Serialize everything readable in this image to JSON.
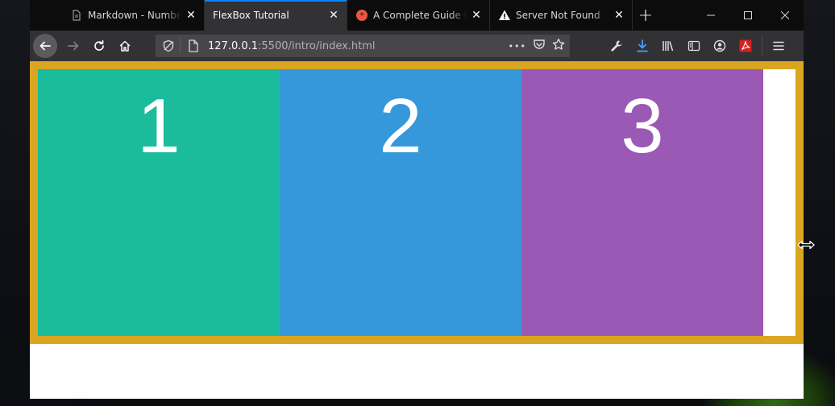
{
  "browser": {
    "tabs": [
      {
        "title": "Markdown - Numbered",
        "favicon": "document-icon",
        "active": false
      },
      {
        "title": "FlexBox Tutorial",
        "favicon": "",
        "active": true
      },
      {
        "title": "A Complete Guide to Flexbox",
        "favicon": "csstricks-icon",
        "active": false
      },
      {
        "title": "Server Not Found",
        "favicon": "warning-icon",
        "active": false
      }
    ],
    "new_tab": "+",
    "url": {
      "host": "127.0.0.1",
      "path": ":5500/intro/index.html"
    },
    "url_more": "•••"
  },
  "page": {
    "boxes": [
      {
        "label": "1",
        "color": "#1abc9c"
      },
      {
        "label": "2",
        "color": "#3498db"
      },
      {
        "label": "3",
        "color": "#9b59b6"
      }
    ],
    "container_color": "#daa520"
  }
}
